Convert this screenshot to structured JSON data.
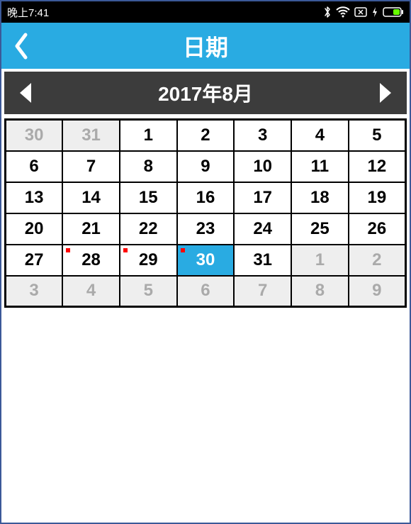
{
  "status": {
    "time": "晚上7:41",
    "bluetooth_icon": "bluetooth",
    "wifi_icon": "wifi",
    "no_sim_icon": "no-sim",
    "charging_icon": "charging",
    "battery_icon": "battery"
  },
  "titlebar": {
    "title": "日期"
  },
  "monthbar": {
    "label": "2017年8月"
  },
  "calendar": {
    "year": 2017,
    "month": 8,
    "selected_day": 30,
    "rows": [
      [
        {
          "n": 30,
          "out": true
        },
        {
          "n": 31,
          "out": true
        },
        {
          "n": 1
        },
        {
          "n": 2
        },
        {
          "n": 3
        },
        {
          "n": 4
        },
        {
          "n": 5
        }
      ],
      [
        {
          "n": 6
        },
        {
          "n": 7
        },
        {
          "n": 8
        },
        {
          "n": 9
        },
        {
          "n": 10
        },
        {
          "n": 11
        },
        {
          "n": 12
        }
      ],
      [
        {
          "n": 13
        },
        {
          "n": 14
        },
        {
          "n": 15
        },
        {
          "n": 16
        },
        {
          "n": 17
        },
        {
          "n": 18
        },
        {
          "n": 19
        }
      ],
      [
        {
          "n": 20
        },
        {
          "n": 21
        },
        {
          "n": 22
        },
        {
          "n": 23
        },
        {
          "n": 24
        },
        {
          "n": 25
        },
        {
          "n": 26
        }
      ],
      [
        {
          "n": 27
        },
        {
          "n": 28,
          "dot": true
        },
        {
          "n": 29,
          "dot": true
        },
        {
          "n": 30,
          "dot": true,
          "selected": true
        },
        {
          "n": 31
        },
        {
          "n": 1,
          "out": true
        },
        {
          "n": 2,
          "out": true
        }
      ],
      [
        {
          "n": 3,
          "out": true
        },
        {
          "n": 4,
          "out": true
        },
        {
          "n": 5,
          "out": true
        },
        {
          "n": 6,
          "out": true
        },
        {
          "n": 7,
          "out": true
        },
        {
          "n": 8,
          "out": true
        },
        {
          "n": 9,
          "out": true
        }
      ]
    ]
  }
}
